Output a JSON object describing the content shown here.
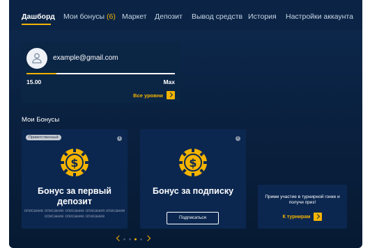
{
  "nav": {
    "items": [
      {
        "label": "Дашборд",
        "active": true
      },
      {
        "label": "Мои бонусы",
        "count": "(6)"
      },
      {
        "label": "Маркет"
      },
      {
        "label": "Депозит"
      },
      {
        "label": "Вывод средств"
      },
      {
        "label": "История"
      },
      {
        "label": "Настройки аккаунта"
      }
    ]
  },
  "user": {
    "email": "example@gmail.com",
    "level_min": "15.00",
    "level_max": "Max",
    "progress_fraction": 0.2,
    "all_levels_label": "Все уровни"
  },
  "bonuses": {
    "section_title": "Мои Бонусы",
    "cards": [
      {
        "tag": "Приветственный",
        "title": "Бонус за первый депозит",
        "description": "описание описание описание описания описание описание описание описание"
      },
      {
        "title": "Бонус за подписку",
        "button_label": "Подписаться"
      }
    ],
    "tournament": {
      "text": "Прими участие в турнирной гонке и получи приз!",
      "link_label": "К турнирам"
    },
    "pager": {
      "pages": 4,
      "active": 3
    }
  },
  "colors": {
    "accent": "#f5b400",
    "background": "#0b2445"
  },
  "icons": {
    "avatar": "user-icon",
    "coin": "dollar-coin-icon",
    "info": "info-icon",
    "arrow": "arrow-right-icon"
  }
}
